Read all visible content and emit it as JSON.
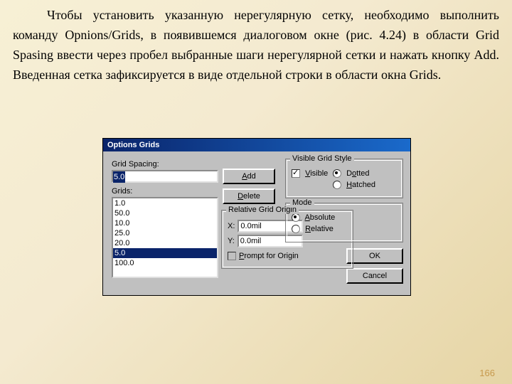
{
  "paragraph": "Чтобы установить указанную нерегулярную сетку, необходимо выполнить команду Opnions/Grids, в появившемся диалоговом окне (рис. 4.24) в области Grid Spasing ввести через пробел выбранные шаги нерегулярной сетки и нажать кнопку Add. Введенная сетка зафиксируется в виде отдельной строки в области окна Grids.",
  "page_number": "166",
  "dialog": {
    "title": "Options Grids",
    "grid_spacing_label": "Grid Spacing:",
    "grid_spacing_value": "5.0",
    "grids_label": "Grids:",
    "grids_items": [
      "1.0",
      "50.0",
      "10.0",
      "25.0",
      "20.0",
      "5.0",
      "100.0"
    ],
    "grids_selected_index": 5,
    "add": "Add",
    "delete": "Delete",
    "vgs": {
      "legend": "Visible Grid Style",
      "visible": "Visible",
      "dotted": "Dotted",
      "hatched": "Hatched"
    },
    "rgo": {
      "legend": "Relative Grid Origin",
      "x_label": "X:",
      "y_label": "Y:",
      "x_value": "0.0mil",
      "y_value": "0.0mil",
      "prompt": "Prompt for Origin"
    },
    "mode": {
      "legend": "Mode",
      "absolute": "Absolute",
      "relative": "Relative"
    },
    "ok": "OK",
    "cancel": "Cancel"
  }
}
